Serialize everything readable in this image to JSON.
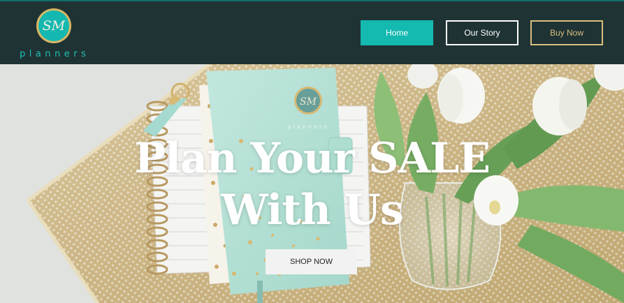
{
  "header": {
    "logo": {
      "monogram": "SM",
      "wordmark": "planners"
    },
    "nav": {
      "home_label": "Home",
      "story_label": "Our Story",
      "buy_label": "Buy Now"
    }
  },
  "hero": {
    "title_line1": "Plan Your SALE",
    "title_line2": "With Us",
    "cta_label": "SHOP NOW",
    "image_subject": "mint planner on gold mesh tray with white tulips"
  },
  "colors": {
    "header_bg": "#1f3334",
    "accent_teal": "#14b9b0",
    "accent_gold": "#d9be7c",
    "text_white": "#ffffff"
  }
}
